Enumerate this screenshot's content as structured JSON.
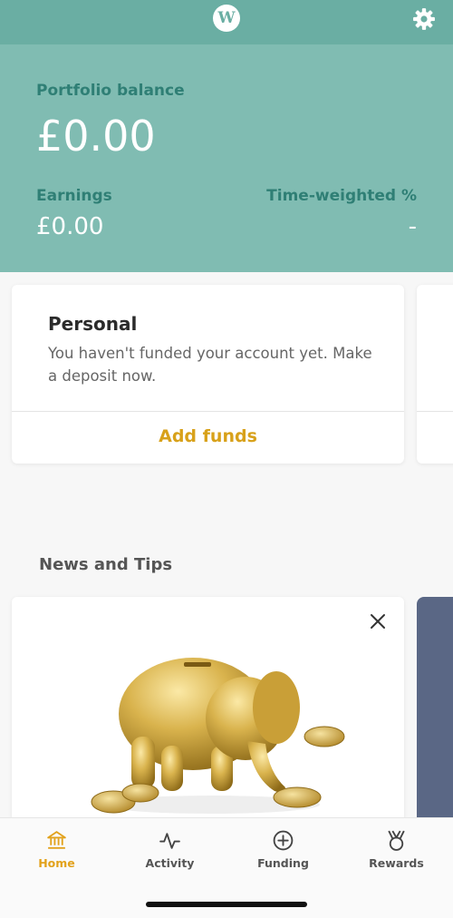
{
  "topbar": {
    "logo_text": "W",
    "logo_icon": "brand-logo-icon",
    "settings_icon": "gear-icon"
  },
  "header": {
    "portfolio_label": "Portfolio balance",
    "portfolio_value": "£0.00",
    "earnings_label": "Earnings",
    "earnings_value": "£0.00",
    "twr_label": "Time-weighted %",
    "twr_value": "-"
  },
  "account_card": {
    "title": "Personal",
    "message": "You haven't funded your account yet. Make a deposit now.",
    "action_label": "Add funds"
  },
  "news": {
    "section_title": "News and Tips",
    "close_icon": "close-icon",
    "image": "golden-elephant-piggy-bank-with-coins"
  },
  "tabs": [
    {
      "label": "Home",
      "icon": "bank-icon",
      "active": true
    },
    {
      "label": "Activity",
      "icon": "pulse-icon",
      "active": false
    },
    {
      "label": "Funding",
      "icon": "plus-circle-icon",
      "active": false
    },
    {
      "label": "Rewards",
      "icon": "medal-icon",
      "active": false
    }
  ],
  "colors": {
    "brand_teal": "#80bcb2",
    "topbar_teal": "#6aaea3",
    "accent_gold": "#d8a11a",
    "news_peek_navy": "#5a6785"
  }
}
